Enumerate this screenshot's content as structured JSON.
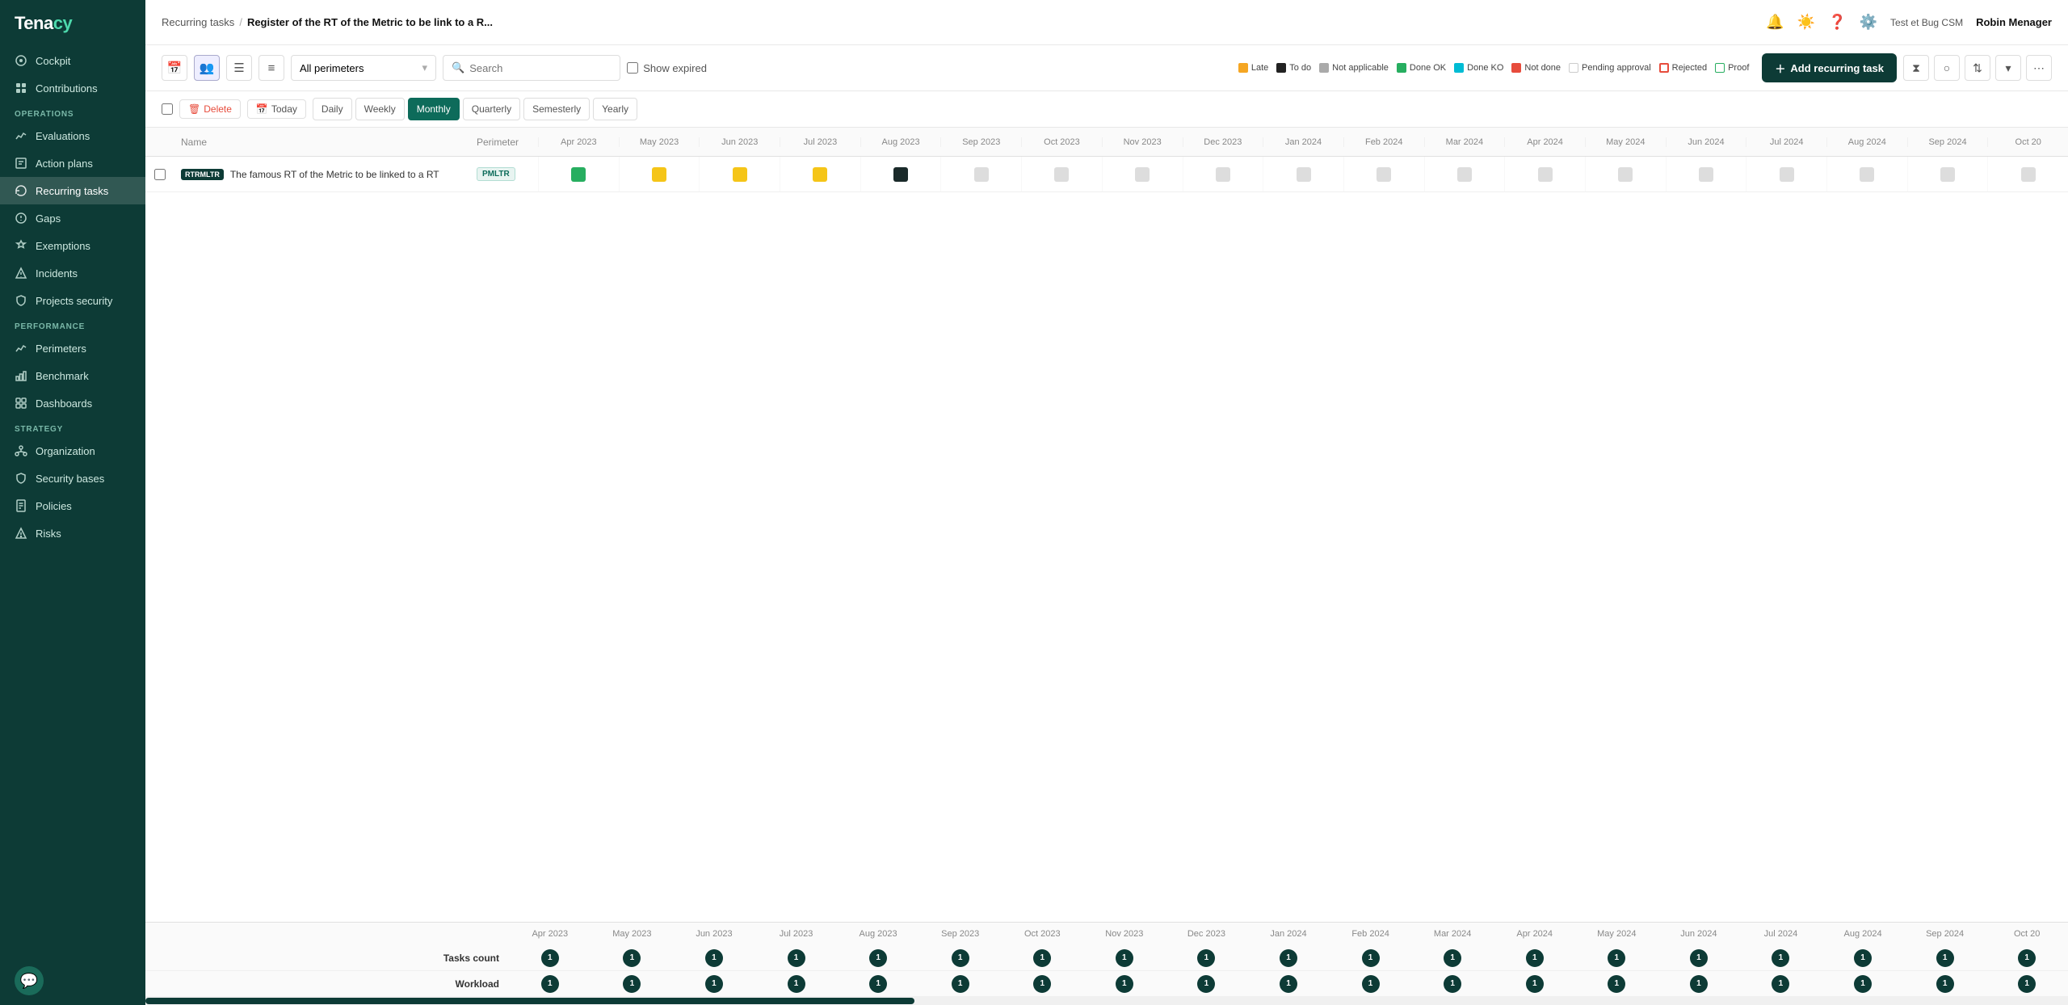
{
  "app": {
    "name": "Tenacy"
  },
  "sidebar": {
    "cockpit_label": "Cockpit",
    "contributions_label": "Contributions",
    "operations_label": "OPERATIONS",
    "evaluations_label": "Evaluations",
    "action_plans_label": "Action plans",
    "recurring_tasks_label": "Recurring tasks",
    "gaps_label": "Gaps",
    "exemptions_label": "Exemptions",
    "incidents_label": "Incidents",
    "projects_security_label": "Projects security",
    "performance_label": "PERFORMANCE",
    "perimeters_label": "Perimeters",
    "benchmark_label": "Benchmark",
    "dashboards_label": "Dashboards",
    "strategy_label": "STRATEGY",
    "organization_label": "Organization",
    "security_bases_label": "Security bases",
    "policies_label": "Policies",
    "risks_label": "Risks"
  },
  "topbar": {
    "breadcrumb_parent": "Recurring tasks",
    "breadcrumb_sep": "/",
    "breadcrumb_current": "Register of the RT of the Metric to be link to a R...",
    "user_context": "Test et Bug CSM",
    "username": "Robin Menager"
  },
  "toolbar": {
    "perimeter_placeholder": "All perimeters",
    "search_placeholder": "Search",
    "show_expired_label": "Show expired",
    "add_button_label": "Add recurring task",
    "delete_label": "Delete",
    "today_label": "Today"
  },
  "freq_buttons": [
    "Daily",
    "Weekly",
    "Monthly",
    "Quarterly",
    "Semesterly",
    "Yearly"
  ],
  "active_freq": "Monthly",
  "legend": [
    {
      "key": "late",
      "label": "Late",
      "color": "#f5a623"
    },
    {
      "key": "todo",
      "label": "To do",
      "color": "#222"
    },
    {
      "key": "na",
      "label": "Not applicable",
      "color": "#aaa"
    },
    {
      "key": "done-ok",
      "label": "Done OK",
      "color": "#27ae60"
    },
    {
      "key": "done-ko",
      "label": "Done KO",
      "color": "#00bcd4"
    },
    {
      "key": "not-done",
      "label": "Not done",
      "color": "#e74c3c"
    },
    {
      "key": "pending",
      "label": "Pending approval",
      "color": "#fff",
      "border": "#ccc"
    },
    {
      "key": "rejected",
      "label": "Rejected",
      "color": "#fff",
      "border": "#e74c3c",
      "dashed": true
    },
    {
      "key": "proof",
      "label": "Proof",
      "color": "#fff",
      "border": "#27ae60"
    }
  ],
  "table": {
    "col_name": "Name",
    "col_perimeter": "Perimeter",
    "months": [
      "Apr 2023",
      "May 2023",
      "Jun 2023",
      "Jul 2023",
      "Aug 2023",
      "Sep 2023",
      "Oct 2023",
      "Nov 2023",
      "Dec 2023",
      "Jan 2024",
      "Feb 2024",
      "Mar 2024",
      "Apr 2024",
      "May 2024",
      "Jun 2024",
      "Jul 2024",
      "Aug 2024",
      "Sep 2024",
      "Oct 20"
    ]
  },
  "rows": [
    {
      "tag": "RTRMLTR",
      "name": "The famous RT of the Metric to be linked to a RT",
      "perimeter_tag": "PMLTR",
      "dots": [
        "green",
        "yellow",
        "yellow",
        "yellow",
        "dark",
        "gray",
        "gray",
        "gray",
        "gray",
        "gray",
        "gray",
        "gray",
        "gray",
        "gray",
        "gray",
        "gray",
        "gray",
        "gray",
        "gray"
      ]
    }
  ],
  "footer": {
    "tasks_count_label": "Tasks count",
    "workload_label": "Workload",
    "months": [
      "Apr 2023",
      "May 2023",
      "Jun 2023",
      "Jul 2023",
      "Aug 2023",
      "Sep 2023",
      "Oct 2023",
      "Nov 2023",
      "Dec 2023",
      "Jan 2024",
      "Feb 2024",
      "Mar 2024",
      "Apr 2024",
      "May 2024",
      "Jun 2024",
      "Jul 2024",
      "Aug 2024",
      "Sep 2024",
      "Oct 20"
    ],
    "tasks_counts": [
      1,
      1,
      1,
      1,
      1,
      1,
      1,
      1,
      1,
      1,
      1,
      1,
      1,
      1,
      1,
      1,
      1,
      1,
      1
    ],
    "workloads": [
      1,
      1,
      1,
      1,
      1,
      1,
      1,
      1,
      1,
      1,
      1,
      1,
      1,
      1,
      1,
      1,
      1,
      1,
      1
    ]
  }
}
